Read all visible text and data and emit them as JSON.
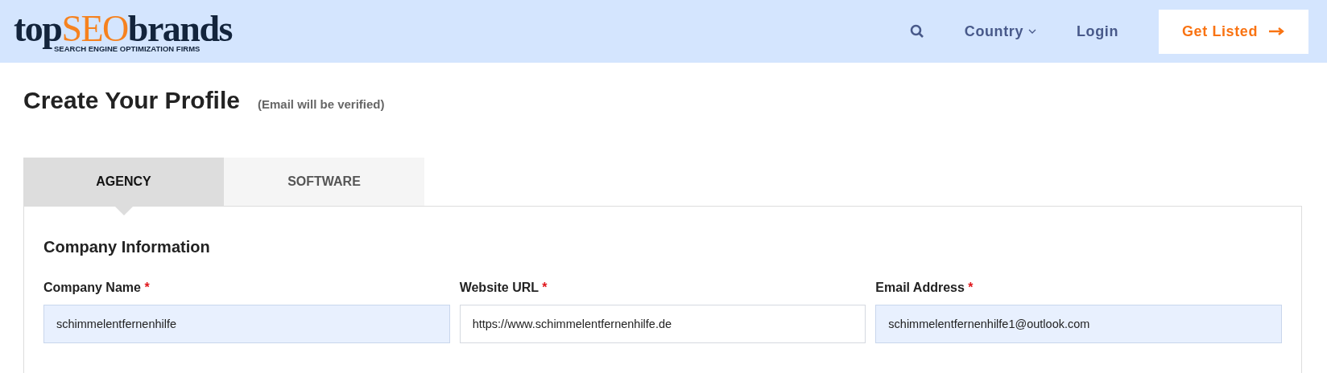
{
  "header": {
    "logo": {
      "top": "top",
      "seo": "SEO",
      "brands": "brands",
      "tagline": "SEARCH ENGINE OPTIMIZATION FIRMS"
    },
    "nav": [
      {
        "kind": "search"
      },
      {
        "kind": "dropdown",
        "label": "Country"
      },
      {
        "kind": "link",
        "label": "Login"
      }
    ],
    "cta": {
      "label": "Get Listed"
    }
  },
  "page": {
    "title": "Create Your Profile",
    "note": "(Email will be verified)"
  },
  "tabs": [
    {
      "label": "AGENCY",
      "selected": true
    },
    {
      "label": "SOFTWARE",
      "selected": false
    }
  ],
  "section": {
    "title": "Company Information",
    "required_mark": "*"
  },
  "fields": [
    {
      "label": "Company Name",
      "required": true,
      "value": "schimmelentfernenhilfe",
      "autofilled": true
    },
    {
      "label": "Website URL",
      "required": true,
      "value": "https://www.schimmelentfernenhilfe.de",
      "autofilled": false
    },
    {
      "label": "Email Address",
      "required": true,
      "value": "schimmelentfernenhilfe1@outlook.com",
      "autofilled": true
    }
  ]
}
